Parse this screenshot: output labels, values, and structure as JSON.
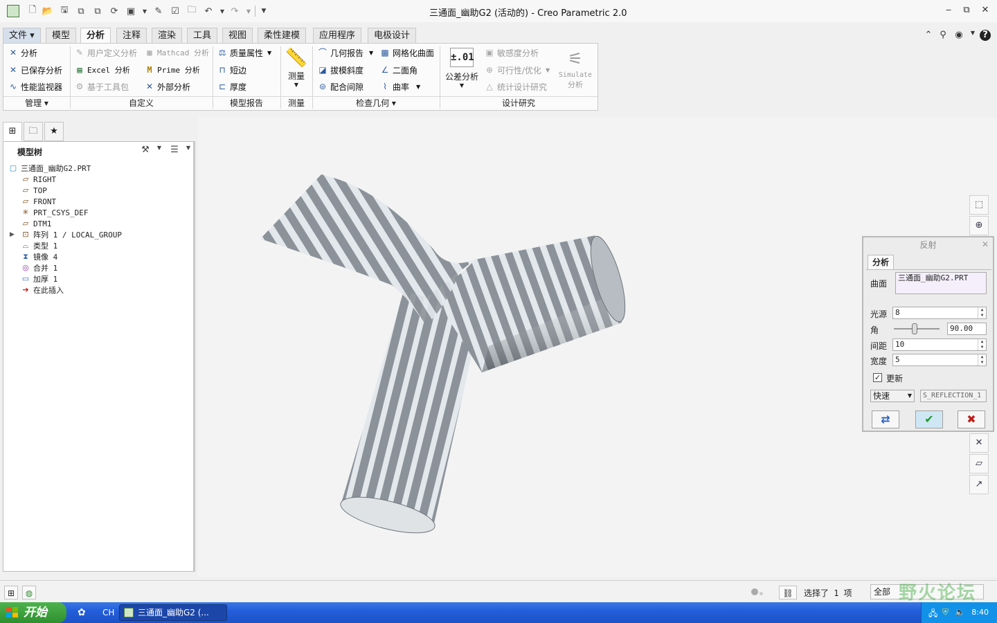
{
  "window": {
    "title": "三通面_幽助G2 (活动的) - Creo Parametric 2.0",
    "min_label": "▭",
    "restore_label": "⧉",
    "close_label": "✕"
  },
  "quick_access": {
    "icons": [
      "new-icon",
      "open-icon",
      "save-icon",
      "regenerate-icon",
      "window-icon",
      "undo-icon",
      "redo-icon",
      "customize-icon"
    ]
  },
  "tabs": [
    {
      "label": "文件 ▾"
    },
    {
      "label": "模型"
    },
    {
      "label": "分析"
    },
    {
      "label": "注释"
    },
    {
      "label": "渲染"
    },
    {
      "label": "工具"
    },
    {
      "label": "视图"
    },
    {
      "label": "柔性建模"
    },
    {
      "label": "应用程序"
    },
    {
      "label": "电极设计"
    }
  ],
  "ribbon": {
    "manage": {
      "analysis": "分析",
      "saved_analysis": "已保存分析",
      "perf_monitor": "性能监视器",
      "group_label": "管理 ▾"
    },
    "custom": {
      "user_defined": "用户定义分析",
      "mathcad": "Mathcad 分析",
      "excel": "Excel 分析",
      "prime": "Prime 分析",
      "toolkit": "基于工具包",
      "external": "外部分析",
      "group_label": "自定义"
    },
    "model_report": {
      "mass_props": "质量属性",
      "short_edge": "短边",
      "thickness": "厚度",
      "group_label": "模型报告"
    },
    "measure": {
      "label": "测量",
      "group_label": "测量"
    },
    "inspect_geometry": {
      "geometry_report": "几何报告",
      "mesh_surface": "网格化曲面",
      "draft": "拔模斜度",
      "dihedral": "二面角",
      "clearance": "配合间隙",
      "curvature": "曲率",
      "group_label": "检查几何 ▾"
    },
    "design_study": {
      "tolerance": "公差分析",
      "tolerance_icon_text": "±.01",
      "sensitivity": "敏感度分析",
      "feasibility": "可行性/优化",
      "statistical": "统计设计研究",
      "simulate": "Simulate",
      "simulate_sub": "分析",
      "group_label": "设计研究"
    }
  },
  "model_tree": {
    "title": "模型树",
    "nodes": [
      {
        "label": "三通面_幽助G2.PRT",
        "icon": "part-icon"
      },
      {
        "label": "RIGHT",
        "icon": "datum-plane-icon"
      },
      {
        "label": "TOP",
        "icon": "datum-plane-icon"
      },
      {
        "label": "FRONT",
        "icon": "datum-plane-icon"
      },
      {
        "label": "PRT_CSYS_DEF",
        "icon": "csys-icon"
      },
      {
        "label": "DTM1",
        "icon": "datum-plane-icon"
      },
      {
        "label": "阵列 1 / LOCAL_GROUP",
        "icon": "pattern-icon"
      },
      {
        "label": "类型 1",
        "icon": "style-icon"
      },
      {
        "label": "镜像 4",
        "icon": "mirror-icon"
      },
      {
        "label": "合并 1",
        "icon": "merge-icon"
      },
      {
        "label": "加厚 1",
        "icon": "thicken-icon"
      },
      {
        "label": "在此插入",
        "icon": "insert-here-icon"
      }
    ]
  },
  "reflection_dialog": {
    "title": "反射",
    "tab": "分析",
    "surface_label": "曲面",
    "surface_value": "三通面_幽助G2.PRT",
    "light_label": "光源",
    "light_value": "8",
    "angle_label": "角",
    "angle_value": "90.00",
    "angle_slider_fraction": 0.45,
    "spacing_label": "间距",
    "spacing_value": "10",
    "width_label": "宽度",
    "width_value": "5",
    "update_label": "更新",
    "update_checked": true,
    "mode_value": "快速",
    "name_value": "S_REFLECTION_1"
  },
  "status_bar": {
    "selection": "选择了 1 项",
    "filter": "全部"
  },
  "taskbar": {
    "start": "开始",
    "lang": "CH",
    "active_task": "三通面_幽助G2 (...",
    "clock": "8:40"
  },
  "watermark": "野火论坛",
  "colors": {
    "accent_blue": "#245edb",
    "start_green": "#3a9e3a",
    "ok_green": "#1a9c2a",
    "cancel_red": "#c0201a",
    "model_gray": "#8b9299",
    "stripe_light": "#e3e8ec"
  }
}
